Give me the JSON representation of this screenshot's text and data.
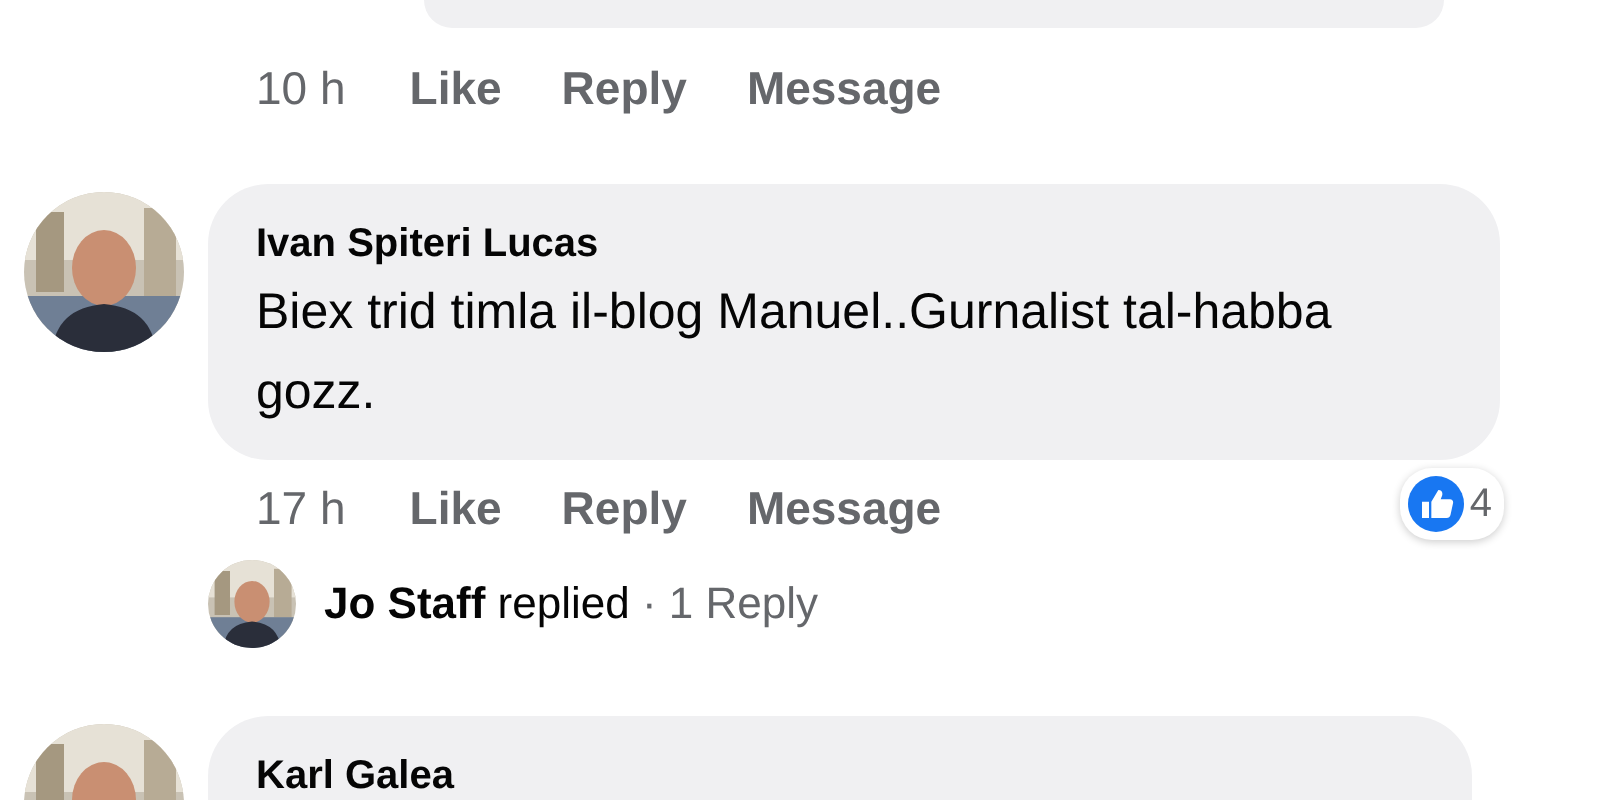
{
  "comments": [
    {
      "actions": {
        "time": "10 h",
        "buttons": [
          "Like",
          "Reply",
          "Message"
        ]
      }
    },
    {
      "author": "Ivan Spiteri Lucas",
      "text": "Biex trid timla il-blog Manuel..Gurnalist tal-habba gozz.",
      "reactions": {
        "count": "4"
      },
      "actions": {
        "time": "17 h",
        "buttons": [
          "Like",
          "Reply",
          "Message"
        ]
      },
      "replies": {
        "author": "Jo Staff",
        "verb": "replied",
        "separator": "·",
        "count": "1 Reply"
      }
    },
    {
      "author": "Karl Galea"
    }
  ]
}
